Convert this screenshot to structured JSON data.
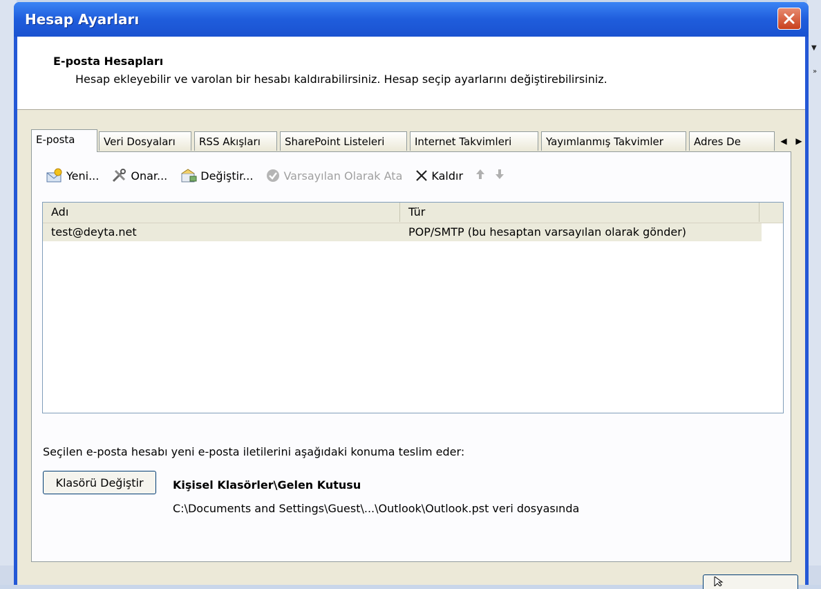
{
  "window": {
    "title": "Hesap Ayarları"
  },
  "header": {
    "title": "E-posta Hesapları",
    "description": "Hesap ekleyebilir ve varolan bir hesabı kaldırabilirsiniz. Hesap seçip ayarlarını değiştirebilirsiniz."
  },
  "tabs": [
    {
      "label": "E-posta"
    },
    {
      "label": "Veri Dosyaları"
    },
    {
      "label": "RSS Akışları"
    },
    {
      "label": "SharePoint Listeleri"
    },
    {
      "label": "Internet Takvimleri"
    },
    {
      "label": "Yayımlanmış Takvimler"
    },
    {
      "label": "Adres De"
    }
  ],
  "toolbar": {
    "new_label": "Yeni...",
    "repair_label": "Onar...",
    "change_label": "Değiştir...",
    "set_default_label": "Varsayılan Olarak Ata",
    "remove_label": "Kaldır"
  },
  "accounts_list": {
    "columns": [
      "Adı",
      "Tür"
    ],
    "rows": [
      {
        "name": "test@deyta.net",
        "type": "POP/SMTP (bu hesaptan varsayılan olarak gönder)"
      }
    ]
  },
  "delivery": {
    "text": "Seçilen e-posta hesabı yeni e-posta iletilerini aşağıdaki konuma teslim eder:",
    "change_folder_label": "Klasörü Değiştir",
    "folder_name": "Kişisel Klasörler\\Gelen Kutusu",
    "folder_path": "C:\\Documents and Settings\\Guest\\...\\Outlook\\Outlook.pst veri dosyasında"
  },
  "colors": {
    "titlebar": "#1f5ddc",
    "close": "#c8401d",
    "face": "#ece9d8"
  }
}
